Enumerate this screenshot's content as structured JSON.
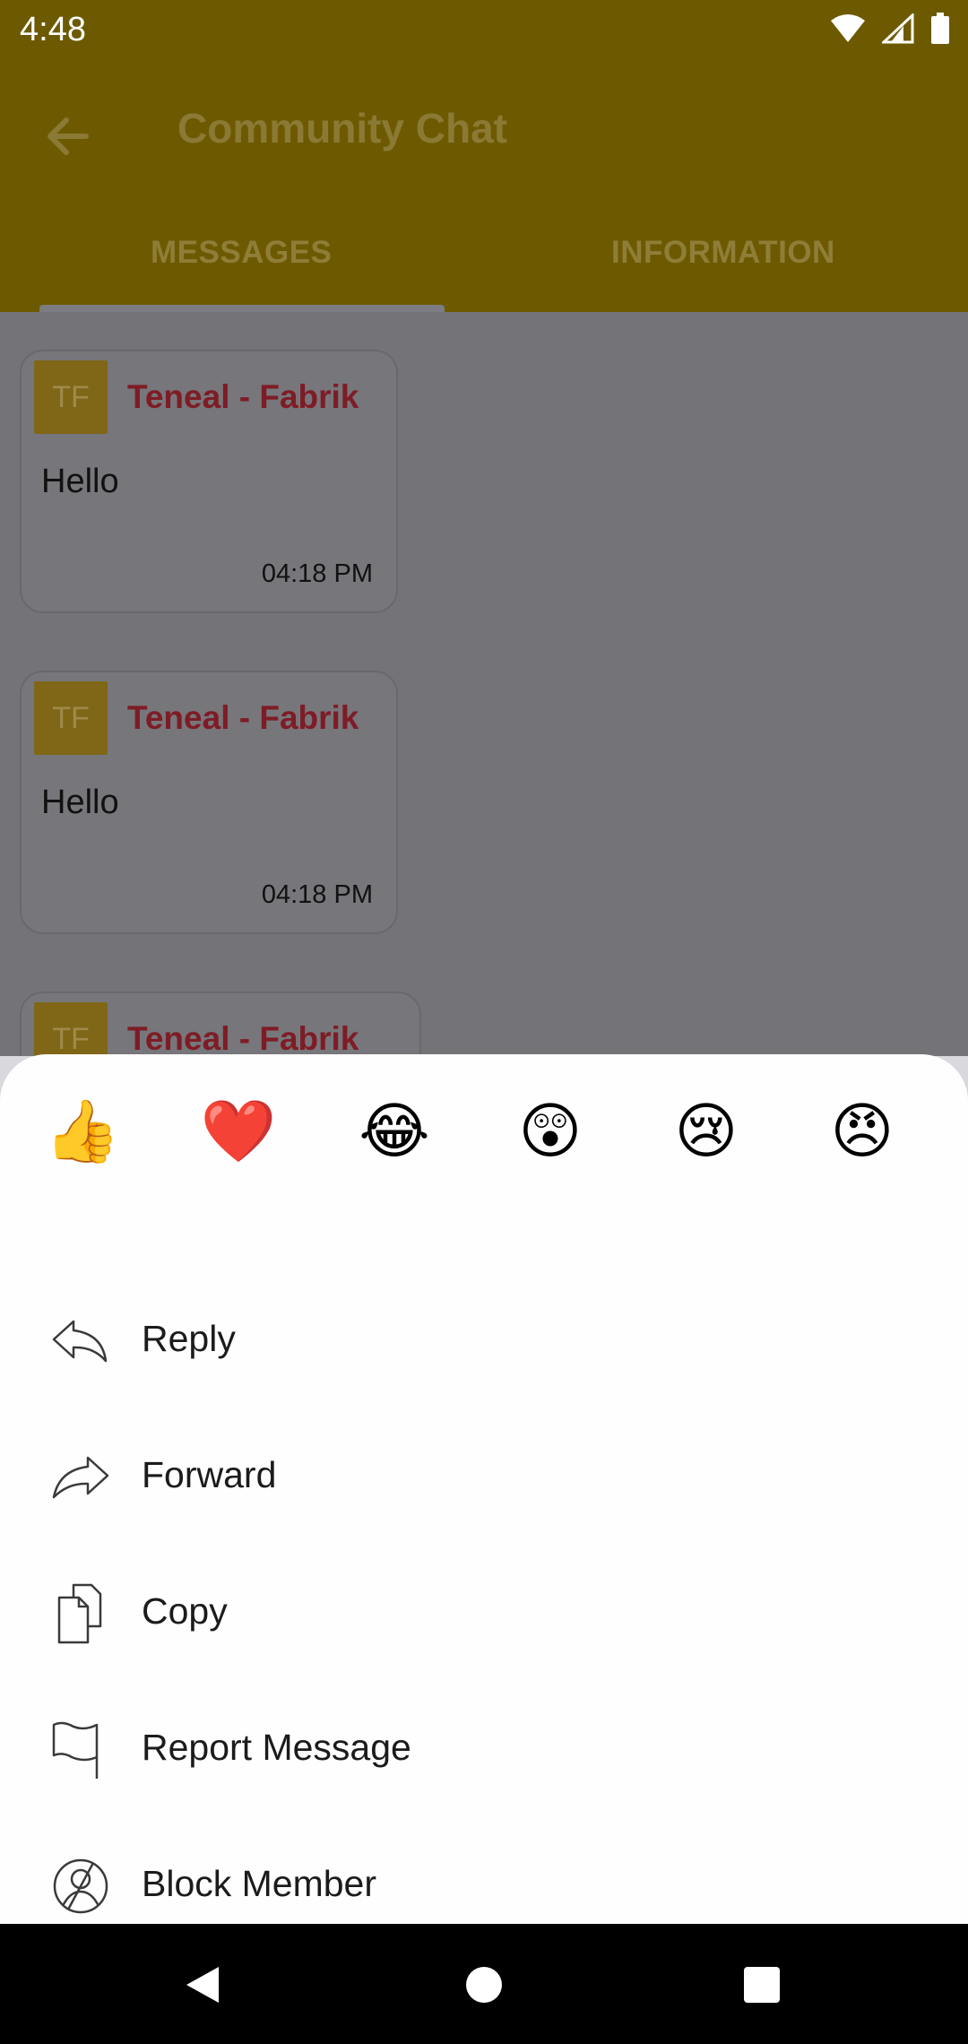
{
  "status_bar": {
    "time": "4:48"
  },
  "app_bar": {
    "title": "Community Chat",
    "tabs": [
      {
        "label": "MESSAGES",
        "selected": true
      },
      {
        "label": "INFORMATION",
        "selected": false
      }
    ]
  },
  "messages": [
    {
      "avatar_initials": "TF",
      "sender": "Teneal - Fabrik",
      "text": "Hello",
      "time": "04:18 PM"
    },
    {
      "avatar_initials": "TF",
      "sender": "Teneal - Fabrik",
      "text": "Hello",
      "time": "04:18 PM"
    },
    {
      "avatar_initials": "TF",
      "sender": "Teneal - Fabrik",
      "text": "",
      "time": ""
    }
  ],
  "reactions": [
    {
      "emoji": "👍",
      "icon": "thumbs-up-icon"
    },
    {
      "emoji": "❤️",
      "icon": "heart-icon"
    },
    {
      "emoji": "😂",
      "icon": "laughing-icon"
    },
    {
      "emoji": "😲",
      "icon": "surprised-icon"
    },
    {
      "emoji": "😢",
      "icon": "sad-icon"
    },
    {
      "emoji": "😠",
      "icon": "angry-icon"
    }
  ],
  "menu": [
    {
      "label": "Reply",
      "icon": "reply-icon"
    },
    {
      "label": "Forward",
      "icon": "forward-icon"
    },
    {
      "label": "Copy",
      "icon": "copy-icon"
    },
    {
      "label": "Report Message",
      "icon": "flag-icon"
    },
    {
      "label": "Block Member",
      "icon": "block-icon"
    }
  ],
  "colors": {
    "app_bar_dimmed": "#6d5a00",
    "sender_name": "#7e1c25",
    "avatar_bg": "#7f6717",
    "sheet_bg": "#fefefe"
  }
}
